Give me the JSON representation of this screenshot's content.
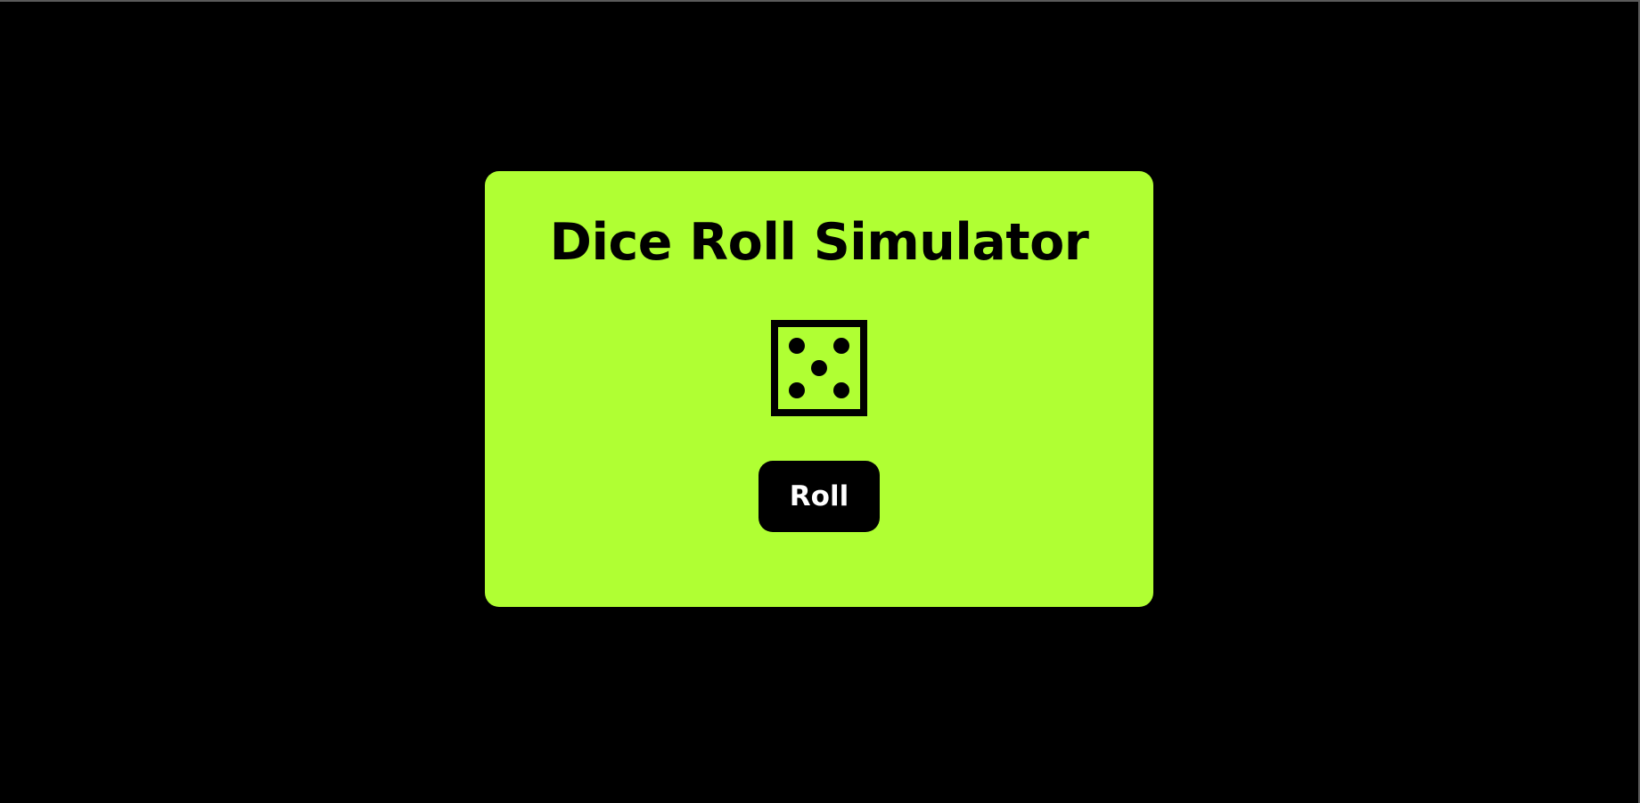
{
  "app": {
    "title": "Dice Roll Simulator"
  },
  "die": {
    "icon": "dice-five-icon",
    "face_value": 5
  },
  "controls": {
    "roll_label": "Roll"
  },
  "colors": {
    "background": "#000000",
    "card": "#b0ff33",
    "button": "#000000",
    "button_text": "#ffffff",
    "text": "#000000"
  }
}
